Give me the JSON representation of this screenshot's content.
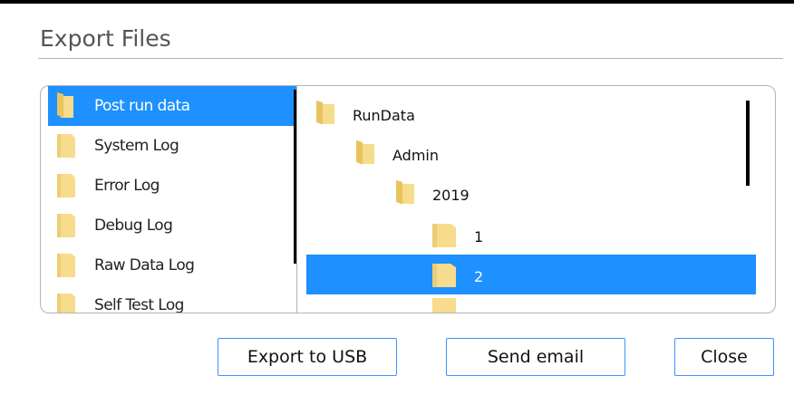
{
  "dialog": {
    "title": "Export Files"
  },
  "log_list": {
    "selected_index": 0,
    "items": [
      {
        "label": "Post run data",
        "icon": "folder-open-icon"
      },
      {
        "label": "System Log",
        "icon": "folder-icon"
      },
      {
        "label": "Error Log",
        "icon": "folder-icon"
      },
      {
        "label": "Debug Log",
        "icon": "folder-icon"
      },
      {
        "label": "Raw Data Log",
        "icon": "folder-icon"
      },
      {
        "label": "Self Test Log",
        "icon": "folder-icon"
      }
    ]
  },
  "folder_tree": {
    "selected_index": 4,
    "items": [
      {
        "label": "RunData",
        "level": 0,
        "icon": "folder-open-icon"
      },
      {
        "label": "Admin",
        "level": 1,
        "icon": "folder-open-icon"
      },
      {
        "label": "2019",
        "level": 2,
        "icon": "folder-open-icon"
      },
      {
        "label": "1",
        "level": 3,
        "icon": "folder-icon"
      },
      {
        "label": "2",
        "level": 3,
        "icon": "folder-icon"
      }
    ]
  },
  "buttons": {
    "export_usb": "Export to USB",
    "send_email": "Send email",
    "close": "Close"
  },
  "colors": {
    "selection": "#1e90ff",
    "button_border": "#3c92ff",
    "folder_fill": "#f6dc8c",
    "folder_shade": "#d9b24a"
  }
}
